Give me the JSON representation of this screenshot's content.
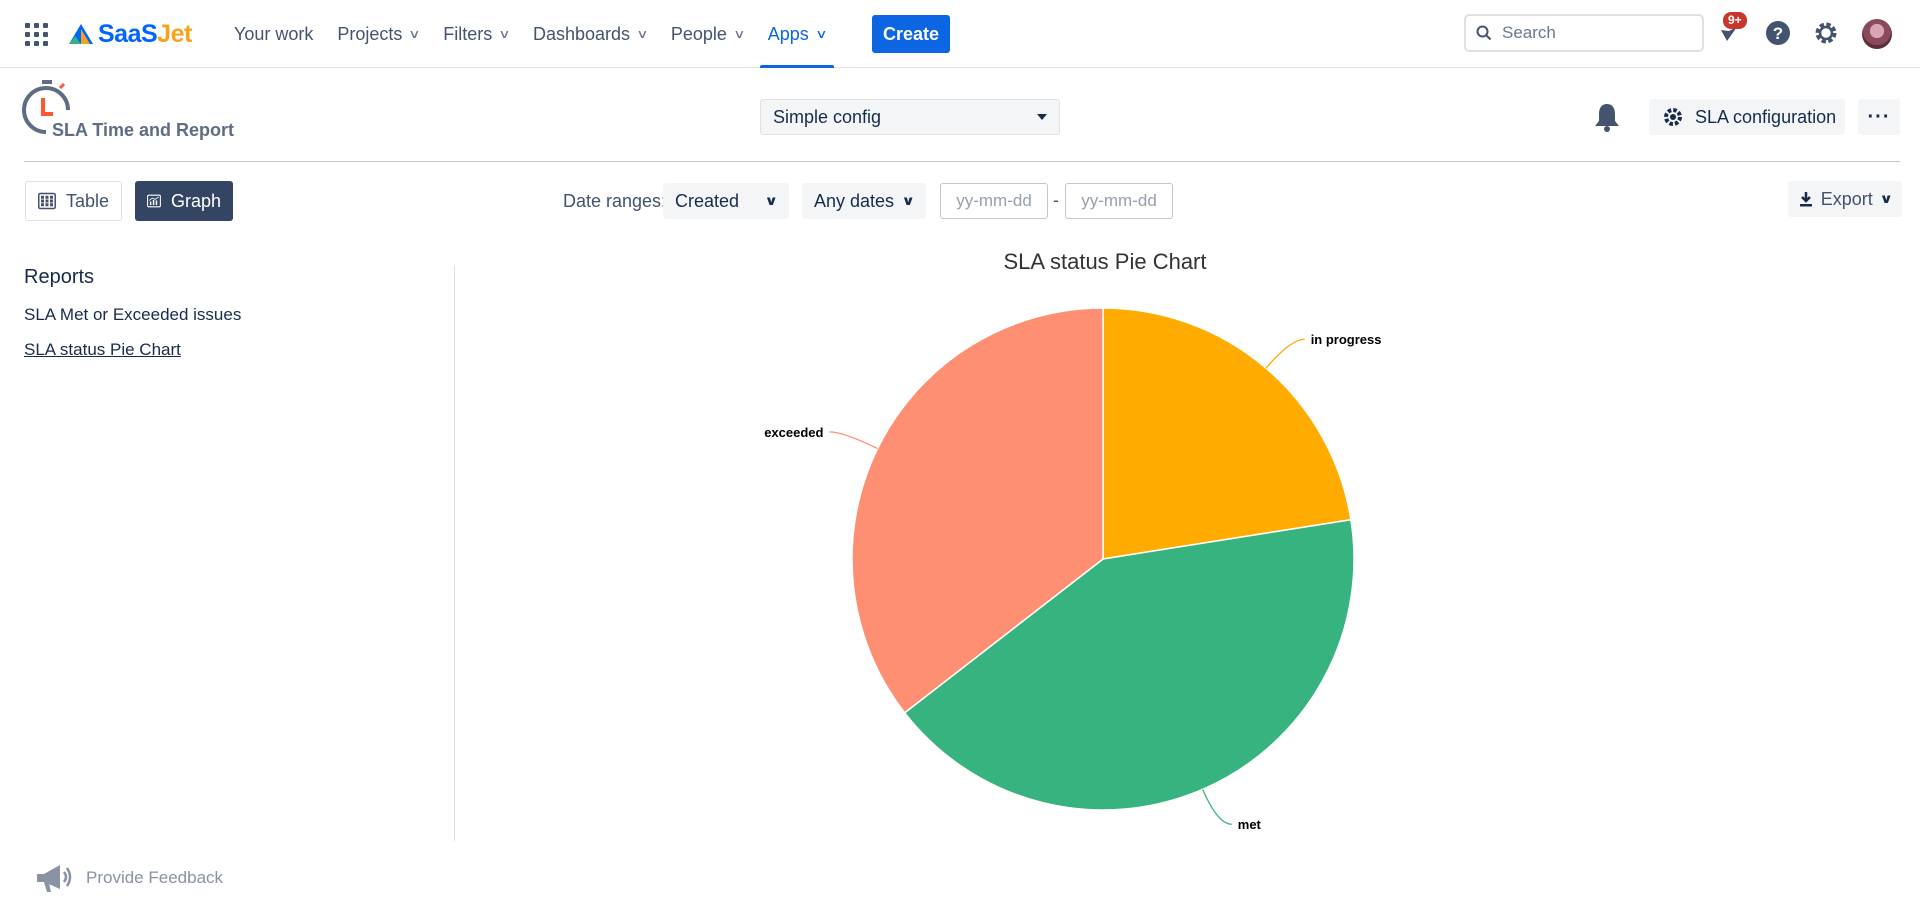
{
  "topnav": {
    "logo_main": "SaaS",
    "logo_accent": "Jet",
    "items": [
      {
        "label": "Your work",
        "chevron": false
      },
      {
        "label": "Projects",
        "chevron": true
      },
      {
        "label": "Filters",
        "chevron": true
      },
      {
        "label": "Dashboards",
        "chevron": true
      },
      {
        "label": "People",
        "chevron": true
      },
      {
        "label": "Apps",
        "chevron": true,
        "active": true
      }
    ],
    "create_label": "Create",
    "search_placeholder": "Search",
    "notification_badge": "9+"
  },
  "app_header": {
    "title": "SLA Time and Report",
    "config_selected": "Simple config",
    "sla_config_label": "SLA configuration",
    "more_label": "···"
  },
  "toolbar": {
    "table_label": "Table",
    "graph_label": "Graph",
    "active_view": "Graph",
    "date_ranges_label": "Date ranges:",
    "date_field_selected": "Created",
    "date_preset_selected": "Any dates",
    "date_from_placeholder": "yy-mm-dd",
    "date_separator": "-",
    "date_to_placeholder": "yy-mm-dd",
    "export_label": "Export"
  },
  "sidebar": {
    "title": "Reports",
    "items": [
      {
        "label": "SLA Met or Exceeded issues",
        "current": false
      },
      {
        "label": "SLA status Pie Chart",
        "current": true
      }
    ]
  },
  "chart_data": {
    "type": "pie",
    "title": "SLA status Pie Chart",
    "slices": [
      {
        "label": "in progress",
        "value": 22.5,
        "color": "#ffab00"
      },
      {
        "label": "met",
        "value": 42.0,
        "color": "#36b37e"
      },
      {
        "label": "exceeded",
        "value": 35.5,
        "color": "#ff8f73"
      }
    ]
  },
  "footer": {
    "feedback_label": "Provide Feedback"
  },
  "colors": {
    "brand_blue": "#0c66e4",
    "graph_button": "#344563"
  }
}
